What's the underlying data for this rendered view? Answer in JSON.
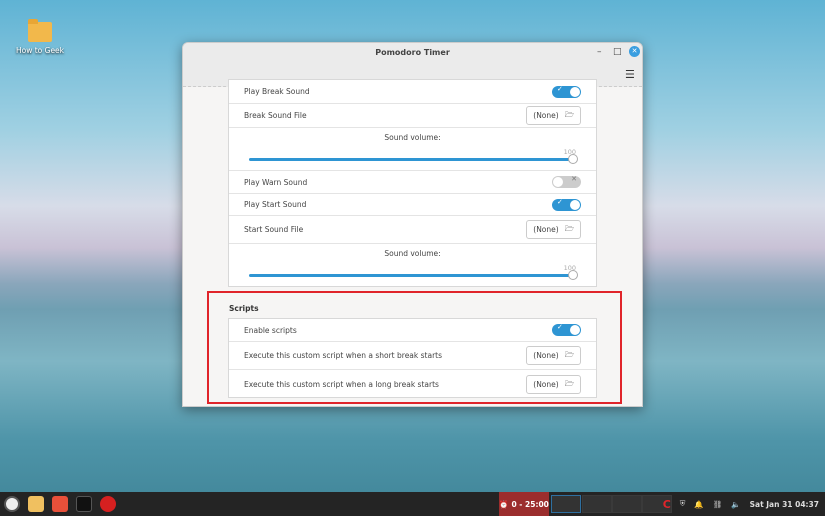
{
  "desktop": {
    "icon_label": "How to Geek"
  },
  "window": {
    "title": "Pomodoro Timer"
  },
  "sounds": {
    "play_break_sound": {
      "label": "Play Break Sound",
      "on": true
    },
    "break_sound_file": {
      "label": "Break Sound File",
      "value": "(None)"
    },
    "break_volume": {
      "label": "Sound volume:",
      "value": "100"
    },
    "play_warn_sound": {
      "label": "Play Warn Sound",
      "on": false
    },
    "play_start_sound": {
      "label": "Play Start Sound",
      "on": true
    },
    "start_sound_file": {
      "label": "Start Sound File",
      "value": "(None)"
    },
    "start_volume": {
      "label": "Sound volume:",
      "value": "100"
    }
  },
  "scripts": {
    "heading": "Scripts",
    "enable": {
      "label": "Enable scripts",
      "on": true
    },
    "short_break": {
      "label": "Execute this custom script when a short break starts",
      "value": "(None)"
    },
    "long_break": {
      "label": "Execute this custom script when a long break starts",
      "value": "(None)"
    }
  },
  "taskbar": {
    "timer": "0 - 25:00",
    "clock": "Sat Jan 31 04:37"
  },
  "colors": {
    "accent": "#2e95d3",
    "highlight": "#e0242a"
  }
}
